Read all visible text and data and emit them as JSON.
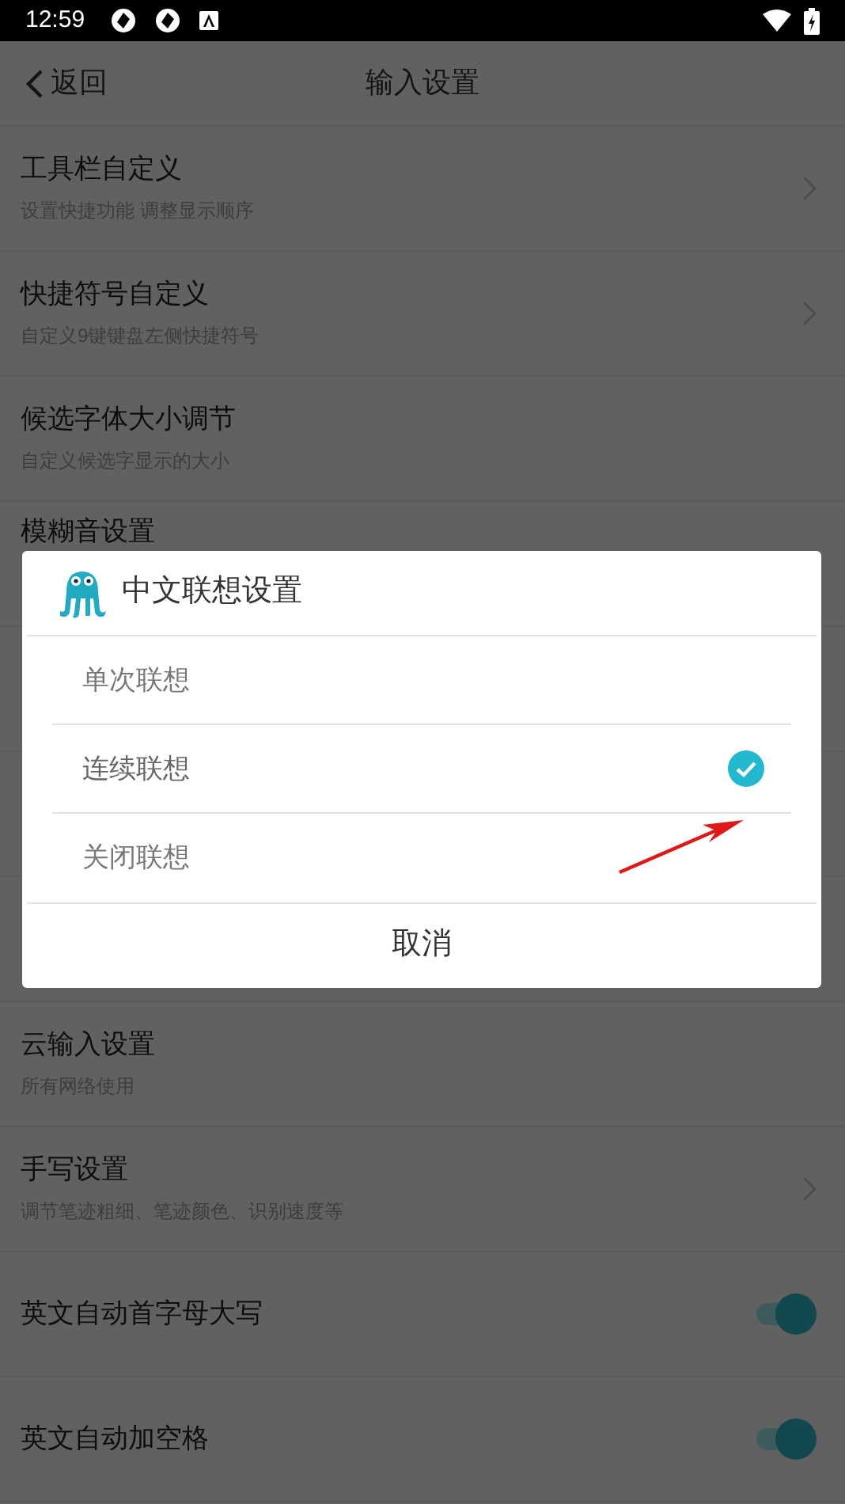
{
  "status_bar": {
    "time": "12:59"
  },
  "header": {
    "back": "返回",
    "title": "输入设置"
  },
  "settings_above": [
    {
      "kind": "nav",
      "title": "工具栏自定义",
      "subtitle": "设置快捷功能 调整显示顺序"
    },
    {
      "kind": "nav",
      "title": "快捷符号自定义",
      "subtitle": "自定义9键键盘左侧快捷符号"
    },
    {
      "kind": "plain",
      "title": "候选字体大小调节",
      "subtitle": "自定义候选字显示的大小"
    },
    {
      "kind": "plain",
      "title": "模糊音设置"
    }
  ],
  "settings_below": [
    {
      "kind": "plain",
      "title": "云输入设置",
      "subtitle": "所有网络使用"
    },
    {
      "kind": "nav",
      "title": "手写设置",
      "subtitle": "调节笔迹粗细、笔迹颜色、识别速度等"
    },
    {
      "kind": "toggle",
      "title": "英文自动首字母大写",
      "on": true
    },
    {
      "kind": "toggle",
      "title": "英文自动加空格",
      "on": true
    }
  ],
  "dialog": {
    "title": "中文联想设置",
    "options": [
      {
        "label": "单次联想",
        "selected": false
      },
      {
        "label": "连续联想",
        "selected": true
      },
      {
        "label": "关闭联想",
        "selected": false
      }
    ],
    "cancel": "取消"
  }
}
